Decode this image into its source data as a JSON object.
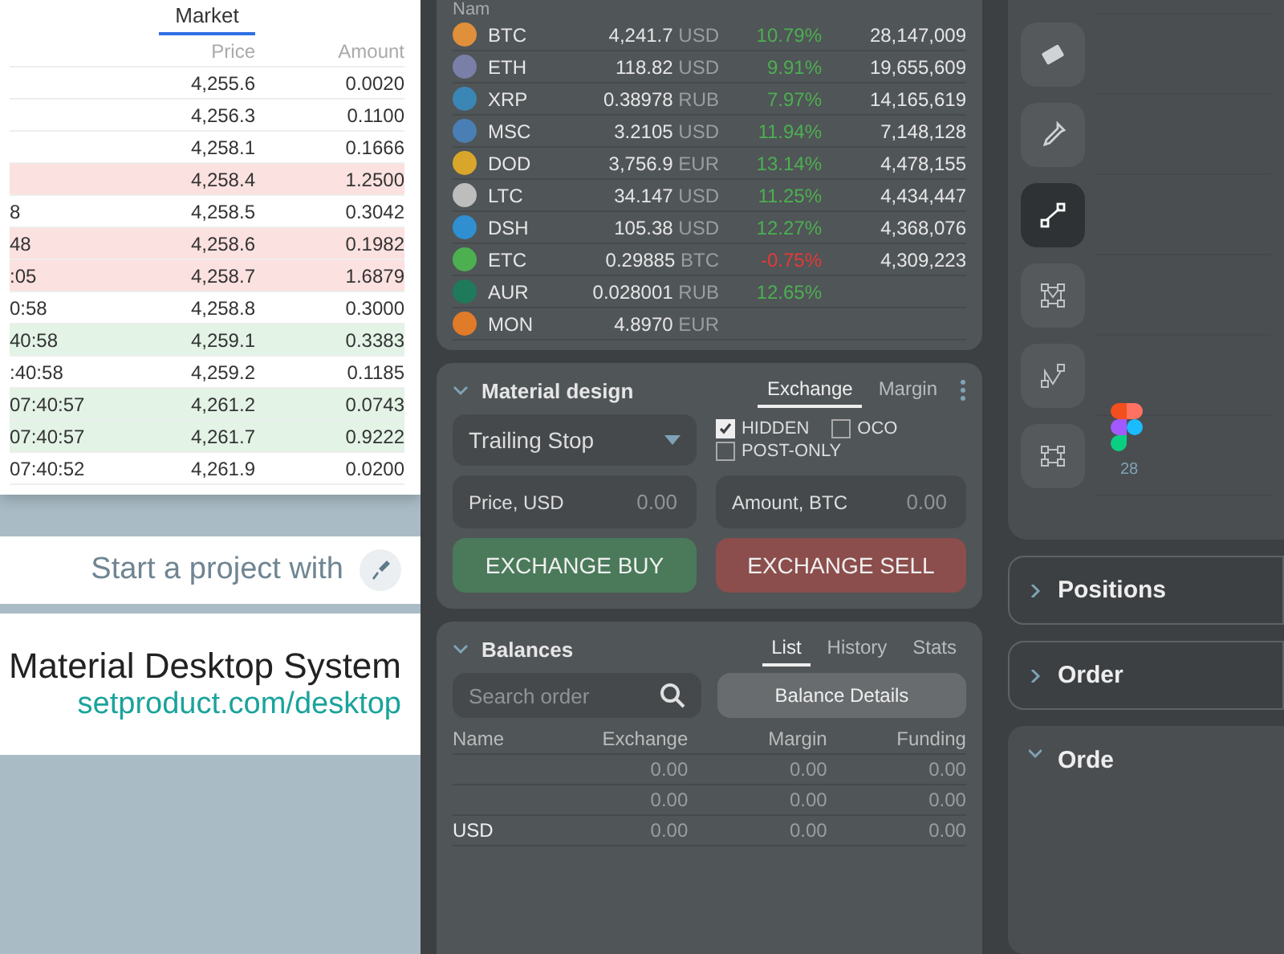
{
  "order_book": {
    "tabs": [
      {
        "label": "Market",
        "selected": true
      }
    ],
    "columns": [
      "Price",
      "Amount"
    ],
    "rows": [
      {
        "price": "4,255.6",
        "amount": "0.0020",
        "kind": "plain"
      },
      {
        "price": "4,256.3",
        "amount": "0.1100",
        "kind": "plain"
      },
      {
        "price": "4,258.1",
        "amount": "0.1666",
        "kind": "plain"
      },
      {
        "price": "4,258.4",
        "amount": "1.2500",
        "kind": "ask"
      },
      {
        "price": "4,258.5",
        "amount": "0.3042",
        "kind": "plain",
        "time": "8"
      },
      {
        "price": "4,258.6",
        "amount": "0.1982",
        "kind": "ask",
        "time": "48"
      },
      {
        "price": "4,258.7",
        "amount": "1.6879",
        "kind": "ask",
        "time": ":05"
      },
      {
        "price": "4,258.8",
        "amount": "0.3000",
        "kind": "plain",
        "time": "0:58"
      },
      {
        "price": "4,259.1",
        "amount": "0.3383",
        "kind": "bid",
        "time": "40:58"
      },
      {
        "price": "4,259.2",
        "amount": "0.1185",
        "kind": "plain",
        "time": ":40:58"
      },
      {
        "price": "4,261.2",
        "amount": "0.0743",
        "kind": "bid",
        "time": "07:40:57"
      },
      {
        "price": "4,261.7",
        "amount": "0.9222",
        "kind": "bid",
        "time": "07:40:57"
      },
      {
        "price": "4,261.9",
        "amount": "0.0200",
        "kind": "plain",
        "time": "07:40:52"
      }
    ]
  },
  "promo": {
    "tagline": "Start a project with",
    "title": "Material Desktop System",
    "link": "setproduct.com/desktop"
  },
  "coins": {
    "header": "Nam",
    "rows": [
      {
        "symbol": "BTC",
        "color": "#e0903a",
        "price": "4,241.7",
        "currency": "USD",
        "change": {
          "text": "10.79%",
          "color": "#4caf50"
        },
        "volume": "28,147,009"
      },
      {
        "symbol": "ETH",
        "color": "#7a7fa8",
        "price": "118.82",
        "currency": "USD",
        "change": {
          "text": "9.91%",
          "color": "#4caf50"
        },
        "volume": "19,655,609"
      },
      {
        "symbol": "XRP",
        "color": "#3a86b5",
        "price": "0.38978",
        "currency": "RUB",
        "change": {
          "text": "7.97%",
          "color": "#4caf50"
        },
        "volume": "14,165,619"
      },
      {
        "symbol": "MSC",
        "color": "#4a7fb5",
        "price": "3.2105",
        "currency": "USD",
        "change": {
          "text": "11.94%",
          "color": "#4caf50"
        },
        "volume": "7,148,128"
      },
      {
        "symbol": "DOD",
        "color": "#d9a62c",
        "price": "3,756.9",
        "currency": "EUR",
        "change": {
          "text": "13.14%",
          "color": "#4caf50"
        },
        "volume": "4,478,155"
      },
      {
        "symbol": "LTC",
        "color": "#bdbdbd",
        "price": "34.147",
        "currency": "USD",
        "change": {
          "text": "11.25%",
          "color": "#4caf50"
        },
        "volume": "4,434,447"
      },
      {
        "symbol": "DSH",
        "color": "#2f8fd0",
        "price": "105.38",
        "currency": "USD",
        "change": {
          "text": "12.27%",
          "color": "#4caf50"
        },
        "volume": "4,368,076"
      },
      {
        "symbol": "ETC",
        "color": "#4caf50",
        "price": "0.29885",
        "currency": "BTC",
        "change": {
          "text": "-0.75%",
          "color": "#e53935"
        },
        "volume": "4,309,223"
      },
      {
        "symbol": "AUR",
        "color": "#1f7a5c",
        "price": "0.028001",
        "currency": "RUB",
        "change": {
          "text": "12.65%",
          "color": "#4caf50"
        }
      },
      {
        "symbol": "MON",
        "color": "#e07b2a",
        "price": "4.8970",
        "currency": "EUR"
      }
    ]
  },
  "order_form": {
    "title": "Material design",
    "tabs": [
      {
        "label": "Exchange",
        "selected": true
      },
      {
        "label": "Margin",
        "selected": false
      }
    ],
    "checkboxes": [
      {
        "label": "HIDDEN",
        "checked": true
      },
      {
        "label": "OCO",
        "checked": false
      },
      {
        "label": "POST-ONLY",
        "checked": false
      }
    ],
    "order_type": "Trailing Stop",
    "fields": [
      {
        "label": "Price, USD",
        "placeholder": "0.00"
      },
      {
        "label": "Amount, BTC",
        "placeholder": "0.00"
      }
    ],
    "buttons": [
      {
        "label": "EXCHANGE BUY",
        "kind": "buy"
      },
      {
        "label": "EXCHANGE SELL",
        "kind": "sell"
      }
    ]
  },
  "balances": {
    "title": "Balances",
    "tabs": [
      {
        "label": "List",
        "selected": true
      },
      {
        "label": "History",
        "selected": false
      },
      {
        "label": "Stats",
        "selected": false
      }
    ],
    "search": {
      "placeholder": "Search order"
    },
    "details_button": "Balance Details",
    "columns": [
      "Name",
      "Exchange",
      "Margin",
      "Funding"
    ],
    "rows": [
      {
        "cells": [
          "",
          "0.00",
          "0.00",
          "0.00"
        ]
      },
      {
        "cells": [
          "",
          "0.00",
          "0.00",
          "0.00"
        ]
      },
      {
        "cells": [
          "USD",
          "0.00",
          "0.00",
          "0.00"
        ]
      }
    ]
  },
  "tools": [
    {
      "kind": "eraser",
      "selected": false
    },
    {
      "kind": "dropper",
      "selected": false
    },
    {
      "kind": "line",
      "selected": true
    },
    {
      "kind": "nodes",
      "selected": false
    },
    {
      "kind": "path",
      "selected": false
    },
    {
      "kind": "rect",
      "selected": false
    }
  ],
  "chart": {
    "axis_label": "28"
  },
  "panels": [
    {
      "title": "Positions",
      "expanded": false
    },
    {
      "title": "Order",
      "expanded": false
    },
    {
      "title": "Orde",
      "expanded": true
    }
  ]
}
